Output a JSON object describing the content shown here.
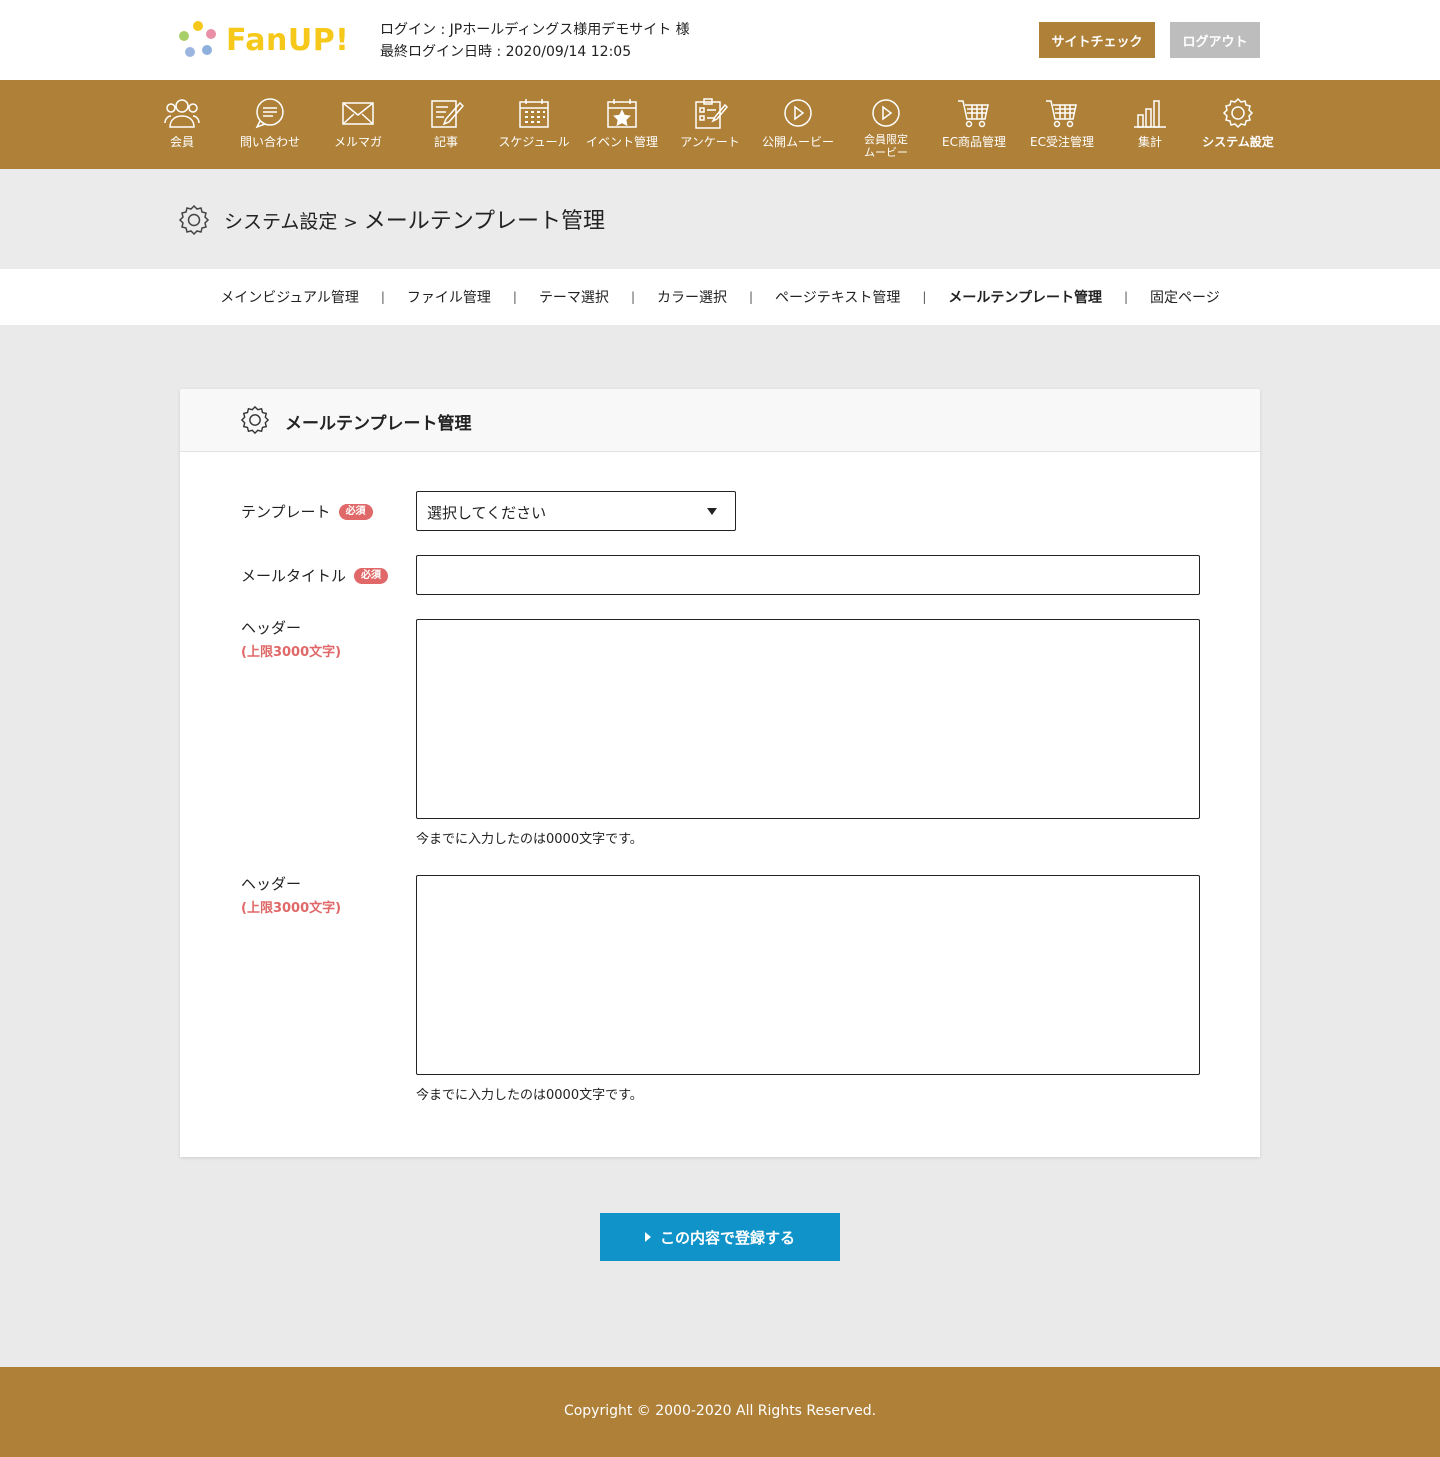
{
  "header": {
    "logo_text": "FanUP!",
    "login_line": "ログイン : JPホールディングス様用デモサイト 様",
    "last_login_line": "最終ログイン日時 : 2020/09/14 12:05",
    "site_check_label": "サイトチェック",
    "logout_label": "ログアウト"
  },
  "nav": {
    "items": [
      {
        "label": "会員",
        "icon": "members-icon"
      },
      {
        "label": "問い合わせ",
        "icon": "chat-icon"
      },
      {
        "label": "メルマガ",
        "icon": "mail-icon"
      },
      {
        "label": "記事",
        "icon": "article-icon"
      },
      {
        "label": "スケジュール",
        "icon": "calendar-icon"
      },
      {
        "label": "イベント管理",
        "icon": "event-icon"
      },
      {
        "label": "アンケート",
        "icon": "survey-icon"
      },
      {
        "label": "公開ムービー",
        "icon": "play-icon"
      },
      {
        "label": "会員限定\nムービー",
        "icon": "play-icon"
      },
      {
        "label": "EC商品管理",
        "icon": "cart-icon"
      },
      {
        "label": "EC受注管理",
        "icon": "cart-icon"
      },
      {
        "label": "集計",
        "icon": "bar-chart-icon"
      },
      {
        "label": "システム設定",
        "icon": "gear-icon",
        "active": true
      }
    ]
  },
  "title": {
    "crumb": "システム設定",
    "separator": ">",
    "current": "メールテンプレート管理"
  },
  "subnav": {
    "items": [
      "メインビジュアル管理",
      "ファイル管理",
      "テーマ選択",
      "カラー選択",
      "ページテキスト管理",
      "メールテンプレート管理",
      "固定ページ"
    ],
    "active": "メールテンプレート管理",
    "separator": "|"
  },
  "form": {
    "card_title": "メールテンプレート管理",
    "required_badge": "必須",
    "template_label": "テンプレート",
    "template_value": "選択してください",
    "mail_title_label": "メールタイトル",
    "mail_title_value": "",
    "header1_label": "ヘッダー",
    "header1_limit": "(上限3000文字)",
    "header1_value": "",
    "header1_counter": "今までに入力したのは0000文字です。",
    "header2_label": "ヘッダー",
    "header2_limit": "(上限3000文字)",
    "header2_value": "",
    "header2_counter": "今までに入力したのは0000文字です。",
    "submit_label": "この内容で登録する"
  },
  "footer": {
    "copyright": "Copyright © 2000-2020 All Rights Reserved."
  },
  "colors": {
    "brand": "#af8038",
    "accent": "#0f93c8",
    "required": "#e06868",
    "logo": "#f5c81a"
  }
}
